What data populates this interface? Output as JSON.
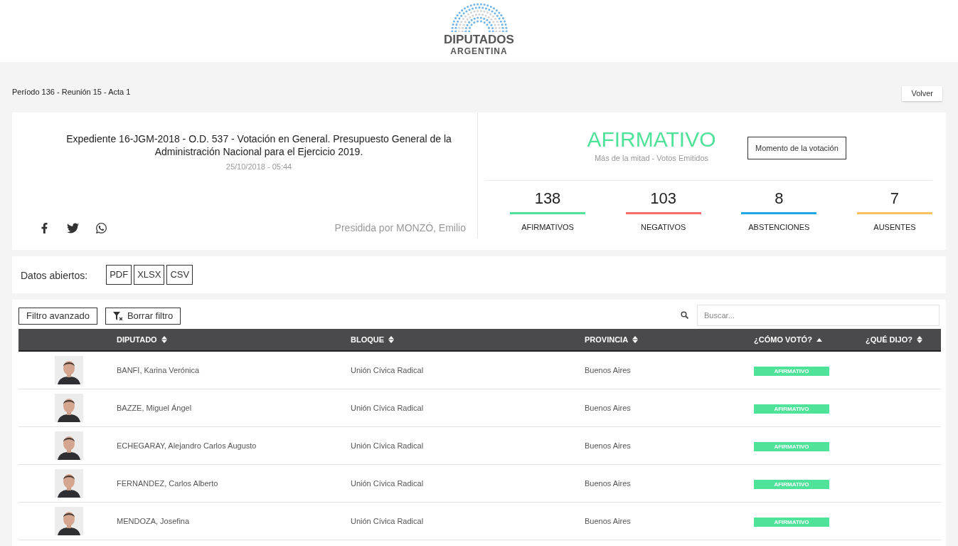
{
  "logo": {
    "title": "DIPUTADOS",
    "subtitle": "ARGENTINA"
  },
  "breadcrumb": "Período 136 - Reunión 15 - Acta 1",
  "back_button": "Volver",
  "summary": {
    "title": "Expediente 16-JGM-2018 - O.D. 537 - Votación en General. Presupuesto General de la Administración Nacional para el Ejercicio 2019.",
    "date": "25/10/2018 - 05:44",
    "presided_by": "Presidida por MONZÓ, Emilio",
    "result": {
      "label": "AFIRMATIVO",
      "color": "#4fe39a"
    },
    "result_note": "Más de la mitad - Votos Emitidos",
    "moment_button": "Momento de la votación",
    "stats": [
      {
        "value": "138",
        "label": "AFIRMATIVOS",
        "color": "#4fe39a"
      },
      {
        "value": "103",
        "label": "NEGATIVOS",
        "color": "#fb6b6b"
      },
      {
        "value": "8",
        "label": "ABSTENCIONES",
        "color": "#1ea7e6"
      },
      {
        "value": "7",
        "label": "AUSENTES",
        "color": "#fbc15e"
      }
    ]
  },
  "open_data": {
    "label": "Datos abiertos:",
    "formats": [
      "PDF",
      "XLSX",
      "CSV"
    ]
  },
  "toolbar": {
    "advanced_filter": "Filtro avanzado",
    "clear_filter": "Borrar filtro",
    "search_placeholder": "Buscar..."
  },
  "table": {
    "columns": [
      {
        "label": "DIPUTADO",
        "sorted": false
      },
      {
        "label": "BLOQUE",
        "sorted": false
      },
      {
        "label": "PROVINCIA",
        "sorted": false
      },
      {
        "label": "¿CÓMO VOTÓ?",
        "sorted": true
      },
      {
        "label": "¿QUÉ DIJO?",
        "sorted": false
      }
    ],
    "rows": [
      {
        "name": "BANFI, Karina Verónica",
        "bloc": "Unión Cívica Radical",
        "province": "Buenos Aires",
        "vote": {
          "label": "AFIRMATIVO",
          "color": "#4fe39a"
        }
      },
      {
        "name": "BAZZE, Miguel Ángel",
        "bloc": "Unión Cívica Radical",
        "province": "Buenos Aires",
        "vote": {
          "label": "AFIRMATIVO",
          "color": "#4fe39a"
        }
      },
      {
        "name": "ECHEGARAY, Alejandro Carlos Augusto",
        "bloc": "Unión Cívica Radical",
        "province": "Buenos Aires",
        "vote": {
          "label": "AFIRMATIVO",
          "color": "#4fe39a"
        }
      },
      {
        "name": "FERNANDEZ, Carlos Alberto",
        "bloc": "Unión Cívica Radical",
        "province": "Buenos Aires",
        "vote": {
          "label": "AFIRMATIVO",
          "color": "#4fe39a"
        }
      },
      {
        "name": "MENDOZA, Josefina",
        "bloc": "Unión Cívica Radical",
        "province": "Buenos Aires",
        "vote": {
          "label": "AFIRMATIVO",
          "color": "#4fe39a"
        }
      }
    ]
  }
}
